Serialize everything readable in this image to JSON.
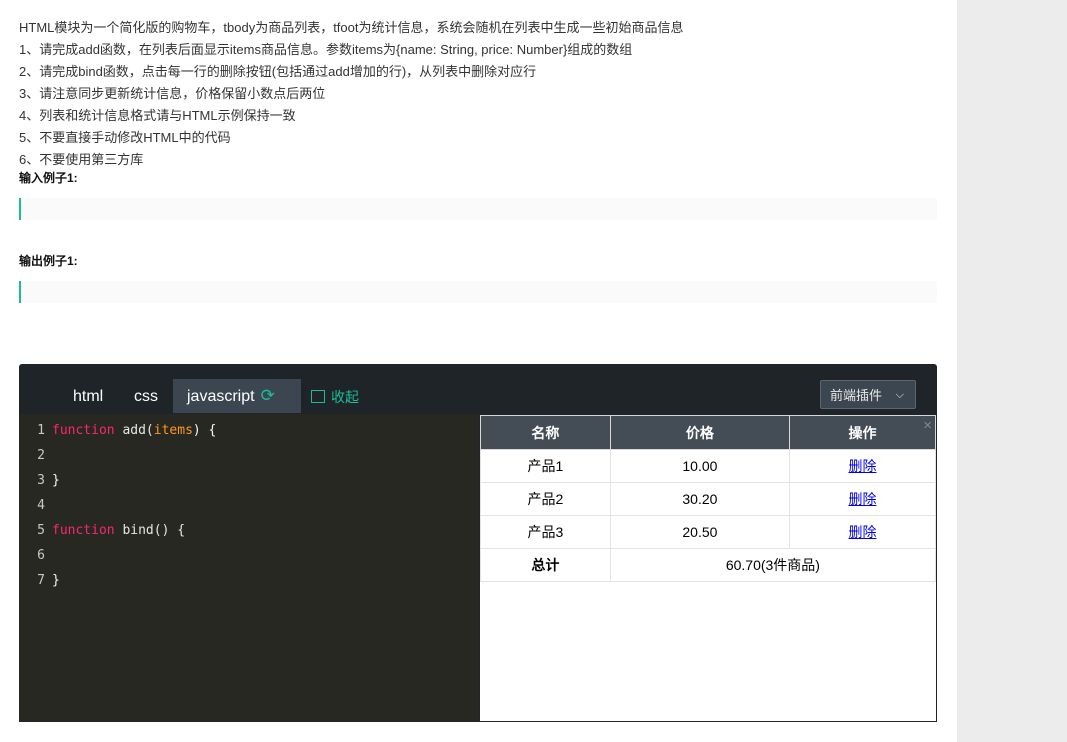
{
  "description": {
    "lines": [
      "HTML模块为一个简化版的购物车，tbody为商品列表，tfoot为统计信息，系统会随机在列表中生成一些初始商品信息",
      "1、请完成add函数，在列表后面显示items商品信息。参数items为{name: String, price: Number}组成的数组",
      "2、请完成bind函数，点击每一行的删除按钮(包括通过add增加的行)，从列表中删除对应行",
      "3、请注意同步更新统计信息，价格保留小数点后两位",
      "4、列表和统计信息格式请与HTML示例保持一致",
      "5、不要直接手动修改HTML中的代码",
      "6、不要使用第三方库"
    ],
    "input_example_label": "输入例子1:",
    "output_example_label": "输出例子1:"
  },
  "editor": {
    "tabs": [
      "html",
      "css",
      "javascript"
    ],
    "active_tab": "javascript",
    "collapse_label": "收起",
    "plugin_label": "前端插件",
    "code_lines": [
      {
        "num": "1",
        "kw": "function",
        "name": " add(",
        "param": "items",
        "rest": ") {"
      },
      {
        "num": "2",
        "kw": "",
        "name": "",
        "param": "",
        "rest": ""
      },
      {
        "num": "3",
        "kw": "",
        "name": "",
        "param": "",
        "rest": "}"
      },
      {
        "num": "4",
        "kw": "",
        "name": "",
        "param": "",
        "rest": ""
      },
      {
        "num": "5",
        "kw": "function",
        "name": " bind() {",
        "param": "",
        "rest": ""
      },
      {
        "num": "6",
        "kw": "",
        "name": "",
        "param": "",
        "rest": ""
      },
      {
        "num": "7",
        "kw": "",
        "name": "",
        "param": "",
        "rest": "}"
      }
    ]
  },
  "preview": {
    "close_symbol": "×",
    "headers": [
      "名称",
      "价格",
      "操作"
    ],
    "rows": [
      {
        "name": "产品1",
        "price": "10.00",
        "action": "删除"
      },
      {
        "name": "产品2",
        "price": "30.20",
        "action": "删除"
      },
      {
        "name": "产品3",
        "price": "20.50",
        "action": "删除"
      }
    ],
    "total_label": "总计",
    "total_value": "60.70(3件商品)"
  }
}
